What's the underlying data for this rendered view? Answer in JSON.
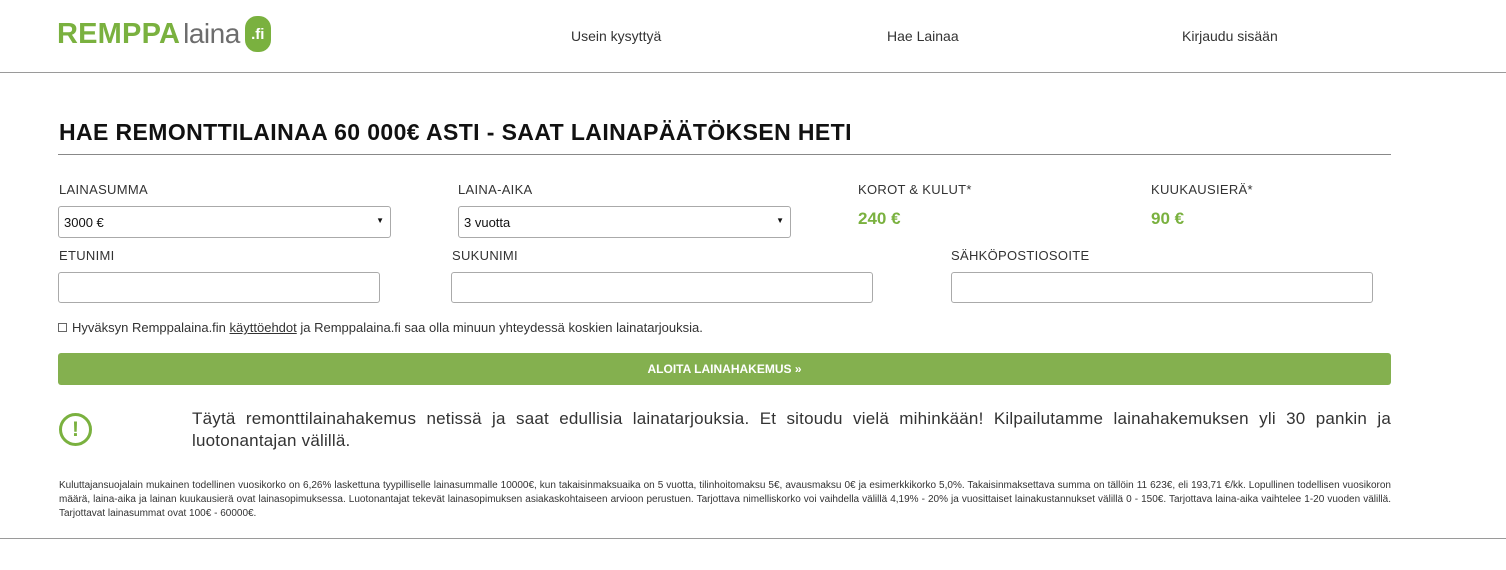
{
  "header": {
    "logo_primary": "REMPPA",
    "logo_secondary": "laina",
    "logo_badge": ".fi",
    "nav": {
      "faq": "Usein kysyttyä",
      "apply": "Hae Lainaa",
      "login": "Kirjaudu sisään"
    }
  },
  "main": {
    "title": "HAE REMONTTILAINAA 60 000€ ASTI - SAAT LAINAPÄÄTÖKSEN HETI",
    "loan_amount": {
      "label": "LAINASUMMA",
      "value": "3000 €"
    },
    "loan_period": {
      "label": "LAINA-AIKA",
      "value": "3 vuotta"
    },
    "costs": {
      "label": "KOROT & KULUT*",
      "value": "240 €"
    },
    "monthly": {
      "label": "KUUKAUSIERÄ*",
      "value": "90 €"
    },
    "first_name": {
      "label": "ETUNIMI",
      "value": ""
    },
    "last_name": {
      "label": "SUKUNIMI",
      "value": ""
    },
    "email": {
      "label": "SÄHKÖPOSTIOSOITE",
      "value": ""
    },
    "consent": {
      "before": "Hyväksyn Remppalaina.fin ",
      "link": "käyttöehdot",
      "after": " ja Remppalaina.fi saa olla minuun yhteydessä koskien lainatarjouksia."
    },
    "submit_label": "ALOITA LAINAHAKEMUS »",
    "info_text": "Täytä remonttilainahakemus netissä ja saat edullisia lainatarjouksia. Et sitoudu vielä mihinkään! Kilpailutamme lainahakemuksen yli 30 pankin ja luotonantajan välillä.",
    "fine_print": "Kuluttajansuojalain mukainen todellinen vuosikorko on 6,26% laskettuna tyypilliselle lainasummalle 10000€, kun takaisinmaksuaika on 5 vuotta, tilinhoitomaksu 5€, avausmaksu 0€ ja esimerkkikorko 5,0%. Takaisinmaksettava summa on tällöin 11 623€, eli 193,71 €/kk. Lopullinen todellisen vuosikoron määrä, laina-aika ja lainan kuukausierä ovat lainasopimuksessa. Luotonantajat tekevät lainasopimuksen asiakaskohtaiseen arvioon perustuen. Tarjottava nimelliskorko voi vaihdella välillä 4,19% - 20% ja vuosittaiset lainakustannukset välillä 0 - 150€. Tarjottava laina-aika vaihtelee 1-20 vuoden välillä. Tarjottavat lainasummat ovat 100€ - 60000€."
  },
  "colors": {
    "brand_green": "#7ab13f",
    "button_green": "#84b04f",
    "logo_gray": "#6d6d6d"
  },
  "icons": {
    "select_arrow": "triangle-down-icon",
    "info": "exclamation-circle-icon"
  }
}
